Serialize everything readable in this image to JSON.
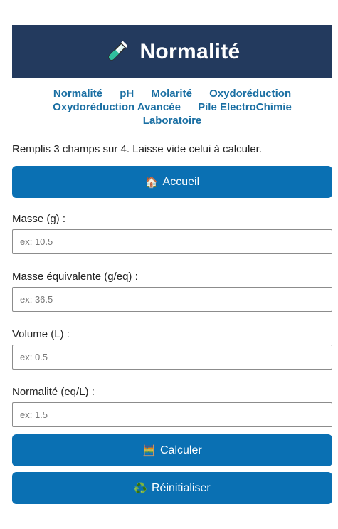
{
  "header": {
    "title": "Normalité",
    "icon": "test-tube-icon"
  },
  "nav": {
    "items": [
      "Normalité",
      "pH",
      "Molarité",
      "Oxydoréduction",
      "Oxydoréduction Avancée",
      "Pile ElectroChimie",
      "Laboratoire"
    ]
  },
  "intro": "Remplis 3 champs sur 4. Laisse vide celui à calculer.",
  "buttons": {
    "home": {
      "label": "Accueil",
      "icon": "🏠"
    },
    "calc": {
      "label": "Calculer",
      "icon": "🧮"
    },
    "reset": {
      "label": "Réinitialiser",
      "icon": "♻️"
    }
  },
  "fields": {
    "masse": {
      "label": "Masse (g) :",
      "placeholder": "ex: 10.5",
      "value": ""
    },
    "masse_eq": {
      "label": "Masse équivalente (g/eq) :",
      "placeholder": "ex: 36.5",
      "value": ""
    },
    "volume": {
      "label": "Volume (L) :",
      "placeholder": "ex: 0.5",
      "value": ""
    },
    "normalite": {
      "label": "Normalité (eq/L) :",
      "placeholder": "ex: 1.5",
      "value": ""
    }
  },
  "colors": {
    "header_bg": "#233a5e",
    "button_bg": "#0a70b3",
    "link": "#1a6fa3"
  }
}
